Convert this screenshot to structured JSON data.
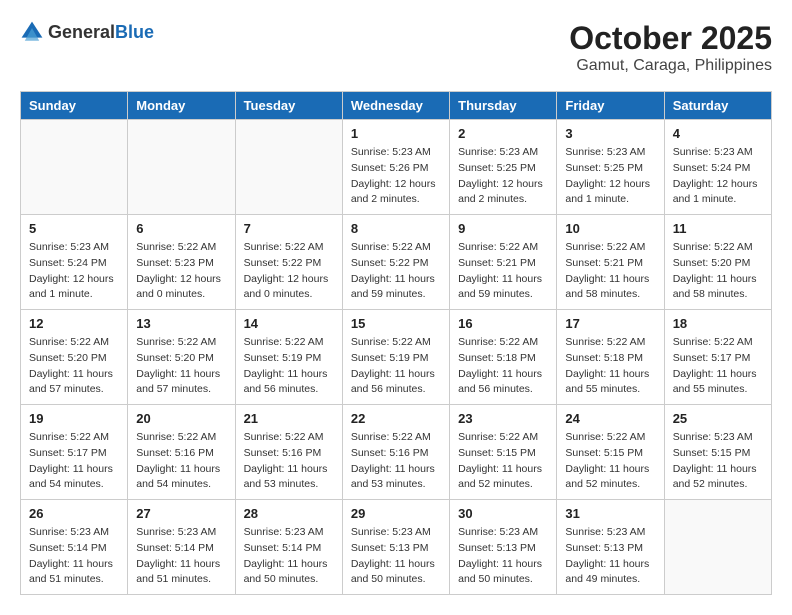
{
  "header": {
    "logo_general": "General",
    "logo_blue": "Blue",
    "month": "October 2025",
    "location": "Gamut, Caraga, Philippines"
  },
  "weekdays": [
    "Sunday",
    "Monday",
    "Tuesday",
    "Wednesday",
    "Thursday",
    "Friday",
    "Saturday"
  ],
  "weeks": [
    [
      {
        "day": "",
        "info": ""
      },
      {
        "day": "",
        "info": ""
      },
      {
        "day": "",
        "info": ""
      },
      {
        "day": "1",
        "info": "Sunrise: 5:23 AM\nSunset: 5:26 PM\nDaylight: 12 hours\nand 2 minutes."
      },
      {
        "day": "2",
        "info": "Sunrise: 5:23 AM\nSunset: 5:25 PM\nDaylight: 12 hours\nand 2 minutes."
      },
      {
        "day": "3",
        "info": "Sunrise: 5:23 AM\nSunset: 5:25 PM\nDaylight: 12 hours\nand 1 minute."
      },
      {
        "day": "4",
        "info": "Sunrise: 5:23 AM\nSunset: 5:24 PM\nDaylight: 12 hours\nand 1 minute."
      }
    ],
    [
      {
        "day": "5",
        "info": "Sunrise: 5:23 AM\nSunset: 5:24 PM\nDaylight: 12 hours\nand 1 minute."
      },
      {
        "day": "6",
        "info": "Sunrise: 5:22 AM\nSunset: 5:23 PM\nDaylight: 12 hours\nand 0 minutes."
      },
      {
        "day": "7",
        "info": "Sunrise: 5:22 AM\nSunset: 5:22 PM\nDaylight: 12 hours\nand 0 minutes."
      },
      {
        "day": "8",
        "info": "Sunrise: 5:22 AM\nSunset: 5:22 PM\nDaylight: 11 hours\nand 59 minutes."
      },
      {
        "day": "9",
        "info": "Sunrise: 5:22 AM\nSunset: 5:21 PM\nDaylight: 11 hours\nand 59 minutes."
      },
      {
        "day": "10",
        "info": "Sunrise: 5:22 AM\nSunset: 5:21 PM\nDaylight: 11 hours\nand 58 minutes."
      },
      {
        "day": "11",
        "info": "Sunrise: 5:22 AM\nSunset: 5:20 PM\nDaylight: 11 hours\nand 58 minutes."
      }
    ],
    [
      {
        "day": "12",
        "info": "Sunrise: 5:22 AM\nSunset: 5:20 PM\nDaylight: 11 hours\nand 57 minutes."
      },
      {
        "day": "13",
        "info": "Sunrise: 5:22 AM\nSunset: 5:20 PM\nDaylight: 11 hours\nand 57 minutes."
      },
      {
        "day": "14",
        "info": "Sunrise: 5:22 AM\nSunset: 5:19 PM\nDaylight: 11 hours\nand 56 minutes."
      },
      {
        "day": "15",
        "info": "Sunrise: 5:22 AM\nSunset: 5:19 PM\nDaylight: 11 hours\nand 56 minutes."
      },
      {
        "day": "16",
        "info": "Sunrise: 5:22 AM\nSunset: 5:18 PM\nDaylight: 11 hours\nand 56 minutes."
      },
      {
        "day": "17",
        "info": "Sunrise: 5:22 AM\nSunset: 5:18 PM\nDaylight: 11 hours\nand 55 minutes."
      },
      {
        "day": "18",
        "info": "Sunrise: 5:22 AM\nSunset: 5:17 PM\nDaylight: 11 hours\nand 55 minutes."
      }
    ],
    [
      {
        "day": "19",
        "info": "Sunrise: 5:22 AM\nSunset: 5:17 PM\nDaylight: 11 hours\nand 54 minutes."
      },
      {
        "day": "20",
        "info": "Sunrise: 5:22 AM\nSunset: 5:16 PM\nDaylight: 11 hours\nand 54 minutes."
      },
      {
        "day": "21",
        "info": "Sunrise: 5:22 AM\nSunset: 5:16 PM\nDaylight: 11 hours\nand 53 minutes."
      },
      {
        "day": "22",
        "info": "Sunrise: 5:22 AM\nSunset: 5:16 PM\nDaylight: 11 hours\nand 53 minutes."
      },
      {
        "day": "23",
        "info": "Sunrise: 5:22 AM\nSunset: 5:15 PM\nDaylight: 11 hours\nand 52 minutes."
      },
      {
        "day": "24",
        "info": "Sunrise: 5:22 AM\nSunset: 5:15 PM\nDaylight: 11 hours\nand 52 minutes."
      },
      {
        "day": "25",
        "info": "Sunrise: 5:23 AM\nSunset: 5:15 PM\nDaylight: 11 hours\nand 52 minutes."
      }
    ],
    [
      {
        "day": "26",
        "info": "Sunrise: 5:23 AM\nSunset: 5:14 PM\nDaylight: 11 hours\nand 51 minutes."
      },
      {
        "day": "27",
        "info": "Sunrise: 5:23 AM\nSunset: 5:14 PM\nDaylight: 11 hours\nand 51 minutes."
      },
      {
        "day": "28",
        "info": "Sunrise: 5:23 AM\nSunset: 5:14 PM\nDaylight: 11 hours\nand 50 minutes."
      },
      {
        "day": "29",
        "info": "Sunrise: 5:23 AM\nSunset: 5:13 PM\nDaylight: 11 hours\nand 50 minutes."
      },
      {
        "day": "30",
        "info": "Sunrise: 5:23 AM\nSunset: 5:13 PM\nDaylight: 11 hours\nand 50 minutes."
      },
      {
        "day": "31",
        "info": "Sunrise: 5:23 AM\nSunset: 5:13 PM\nDaylight: 11 hours\nand 49 minutes."
      },
      {
        "day": "",
        "info": ""
      }
    ]
  ]
}
